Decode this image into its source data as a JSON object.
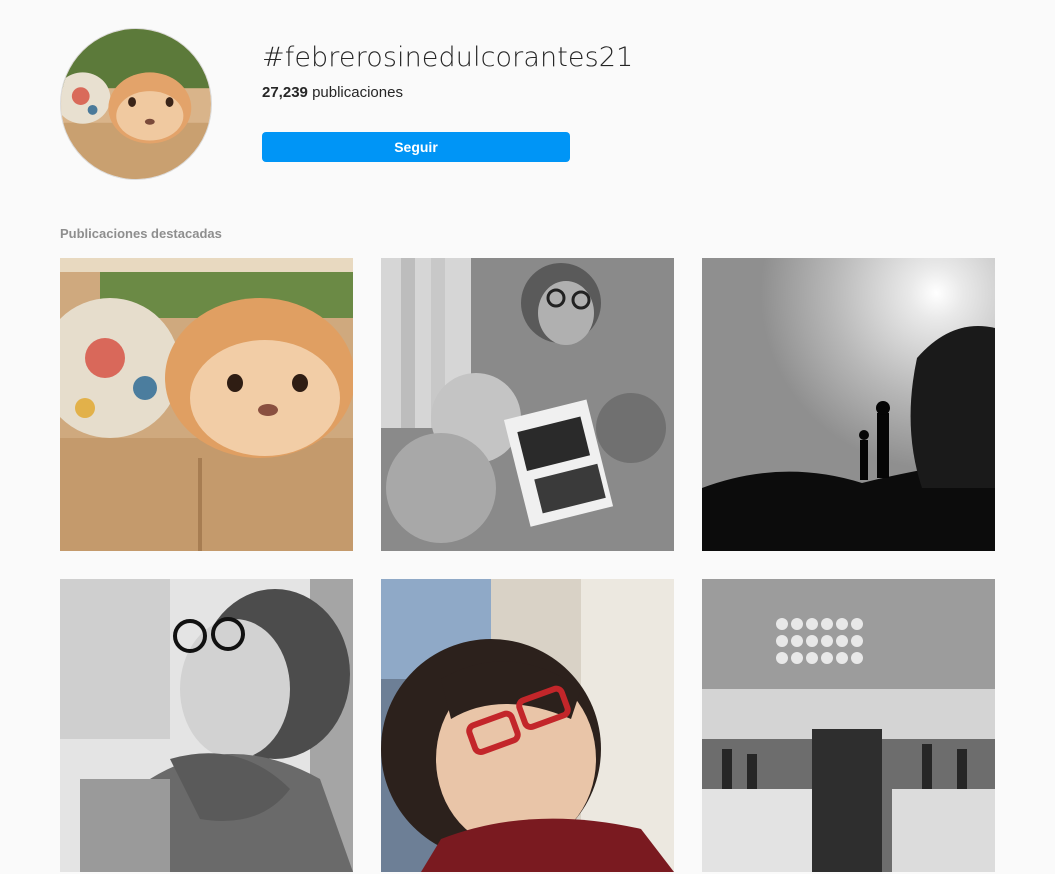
{
  "profile": {
    "hashtag": "#febrerosinedulcorantes21",
    "posts_count": "27,239",
    "posts_label": "publicaciones",
    "follow_label": "Seguir"
  },
  "section": {
    "title": "Publicaciones destacadas"
  },
  "posts": [
    {
      "subject": "rabbit on sofa",
      "tone": "color"
    },
    {
      "subject": "family with ultrasound photo",
      "tone": "bw"
    },
    {
      "subject": "silhouettes at sunset",
      "tone": "bw"
    },
    {
      "subject": "woman with glasses and scarf",
      "tone": "bw"
    },
    {
      "subject": "woman with red glasses",
      "tone": "color"
    },
    {
      "subject": "restaurant interior",
      "tone": "bw"
    }
  ],
  "colors": {
    "accent": "#0095f6",
    "background": "#fafafa",
    "muted_text": "#8e8e8e"
  }
}
